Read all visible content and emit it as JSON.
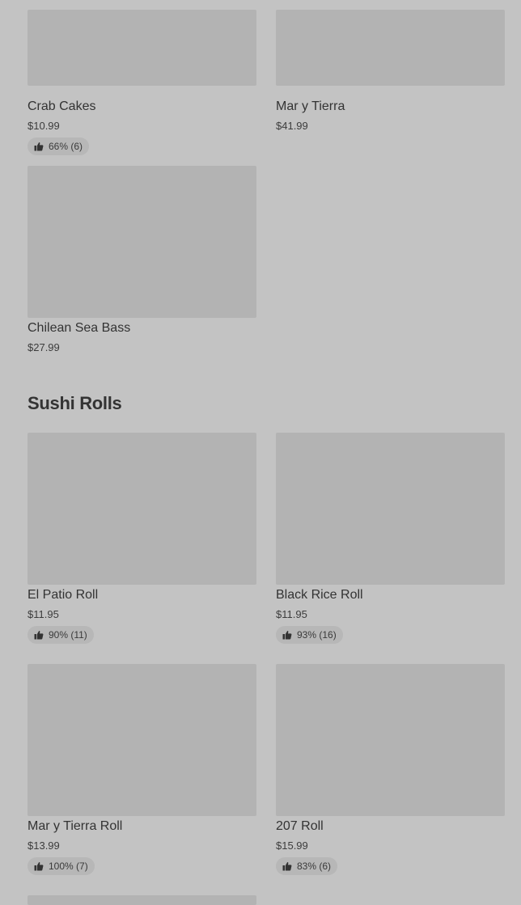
{
  "top_items": [
    {
      "name": "Crab Cakes",
      "price": "$10.99",
      "rating": "66% (6)"
    },
    {
      "name": "Mar y Tierra",
      "price": "$41.99"
    },
    {
      "name": "Chilean Sea Bass",
      "price": "$27.99"
    }
  ],
  "sushi": {
    "title": "Sushi Rolls",
    "items": [
      {
        "name": "El Patio Roll",
        "price": "$11.95",
        "rating": "90% (11)"
      },
      {
        "name": "Black Rice Roll",
        "price": "$11.95",
        "rating": "93% (16)"
      },
      {
        "name": "Mar y Tierra Roll",
        "price": "$13.99",
        "rating": "100% (7)"
      },
      {
        "name": "207 Roll",
        "price": "$15.99",
        "rating": "83% (6)"
      }
    ]
  },
  "icons": {
    "rating": "thumbs-up-icon"
  },
  "colors": {
    "background": "#c3c3c3",
    "image_placeholder": "#b3b3b3",
    "badge": "#b7b7b7"
  }
}
